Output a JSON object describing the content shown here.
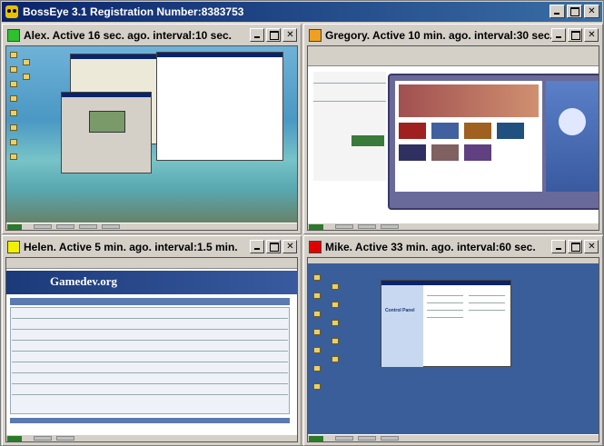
{
  "app": {
    "title": "BossEye 3.1 Registration Number:8383753",
    "icon": "boss-eye-icon"
  },
  "window_controls": {
    "minimize": "minimize-icon",
    "maximize": "maximize-icon",
    "close": "close-icon"
  },
  "panes": [
    {
      "label": "Alex. Active 16 sec. ago. interval:10 sec.",
      "status_color": "#2ec02e",
      "screen_theme": "beach-desktop"
    },
    {
      "label": "Gregory. Active 10 min. ago. interval:30 sec.",
      "status_color": "#f0a020",
      "screen_theme": "browser-media-player"
    },
    {
      "label": "Helen. Active 5 min. ago. interval:1.5 min.",
      "status_color": "#f0f000",
      "screen_theme": "gamedev-forum"
    },
    {
      "label": "Mike. Active 33 min. ago. interval:60 sec.",
      "status_color": "#e00000",
      "screen_theme": "blue-desktop-control-panel"
    }
  ],
  "screens": {
    "gamedev_logo": "Gamedev.org",
    "control_panel_title": "Control Panel"
  }
}
